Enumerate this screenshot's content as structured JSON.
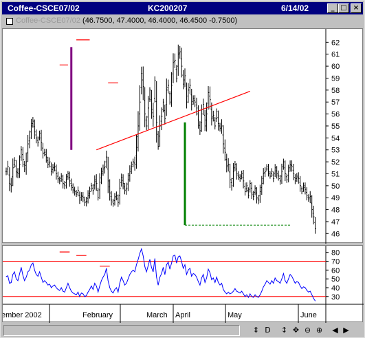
{
  "window": {
    "title_left": "Coffee-CSCE07/02",
    "title_center": "KC200207",
    "title_right": "6/14/02",
    "btn_min": "_",
    "btn_max": "□",
    "btn_close": "×"
  },
  "infobar": {
    "symbol": "Coffee-CSCE07/02",
    "values": "(46.7500, 47.4000, 46.4000, 46.4500 -0.7500)"
  },
  "statusbar": {
    "icons": [
      "scroll-arrows-icon",
      "draw-icon",
      "move-vertical-icon",
      "crosshair-icon",
      "zoom-out-icon",
      "zoom-in-icon",
      "scroll-left-icon",
      "scroll-right-icon"
    ],
    "glyphs": [
      "⇕",
      "D",
      "↕",
      "✥",
      "⊖",
      "⊕",
      "◀",
      "▶"
    ]
  },
  "chart_data": [
    {
      "type": "ohlc",
      "xlabels": [
        "ember 2002",
        "February",
        "March",
        "April",
        "May",
        "June"
      ],
      "ylim": [
        45.5,
        63
      ],
      "yticks": [
        46,
        47,
        48,
        49,
        50,
        51,
        52,
        53,
        54,
        55,
        56,
        57,
        58,
        59,
        60,
        61,
        62
      ],
      "series_color": "#000000",
      "closes": [
        51.2,
        51.6,
        50.2,
        50.0,
        51.5,
        52.1,
        51.2,
        51.0,
        51.8,
        53.0,
        52.2,
        51.4,
        52.0,
        53.5,
        54.0,
        55.0,
        55.4,
        54.5,
        54.0,
        53.6,
        54.4,
        53.6,
        52.7,
        52.8,
        52.4,
        51.8,
        52.0,
        51.2,
        51.5,
        51.6,
        51.0,
        50.6,
        50.4,
        50.8,
        50.2,
        50.0,
        50.5,
        51.0,
        50.4,
        50.0,
        49.7,
        49.5,
        49.3,
        49.6,
        48.8,
        49.2,
        49.0,
        48.6,
        48.7,
        49.2,
        49.5,
        50.0,
        49.6,
        50.5,
        50.2,
        49.0,
        50.3,
        51.0,
        51.4,
        51.6,
        52.4,
        50.4,
        49.4,
        48.8,
        48.5,
        49.0,
        49.2,
        48.6,
        49.8,
        50.7,
        50.2,
        49.6,
        49.8,
        50.5,
        51.2,
        51.6,
        52.0,
        51.8,
        53.2,
        55.0,
        57.0,
        59.4,
        58.3,
        56.0,
        55.0,
        56.5,
        58.0,
        56.4,
        55.8,
        58.8,
        55.3,
        53.3,
        55.0,
        55.8,
        57.0,
        55.6,
        58.0,
        58.4,
        57.0,
        58.4,
        60.3,
        60.5,
        59.0,
        61.0,
        61.2,
        60.0,
        58.5,
        59.2,
        57.0,
        58.0,
        58.4,
        56.8,
        57.3,
        57.0,
        56.5,
        55.5,
        54.6,
        56.0,
        56.8,
        55.0,
        56.0,
        57.8,
        57.2,
        55.6,
        55.9,
        55.0,
        56.2,
        55.2,
        54.8,
        55.0,
        53.5,
        52.8,
        51.6,
        51.8,
        50.5,
        50.0,
        51.2,
        51.8,
        51.0,
        50.8,
        50.6,
        51.0,
        50.4,
        49.5,
        50.0,
        49.2,
        50.2,
        49.4,
        49.1,
        49.8,
        49.0,
        48.8,
        49.5,
        50.2,
        51.0,
        51.2,
        51.6,
        51.2,
        50.8,
        51.2,
        50.6,
        51.5,
        51.0,
        50.8,
        50.4,
        51.2,
        52.0,
        51.0,
        50.5,
        51.2,
        51.8,
        51.6,
        51.0,
        50.4,
        50.8,
        50.6,
        50.0,
        49.5,
        50.0,
        49.7,
        49.2,
        48.9,
        49.1,
        48.0,
        47.4,
        46.45
      ],
      "annotations": {
        "trendline_red": [
          [
            54,
            53.0
          ],
          [
            146,
            57.9
          ]
        ],
        "purple_bar": [
          [
            39,
            53.0
          ],
          [
            39,
            61.6
          ]
        ],
        "green_vertical": [
          [
            107,
            55.3
          ],
          [
            107,
            46.7
          ]
        ],
        "green_dashed": [
          [
            107,
            46.7
          ],
          [
            170,
            46.7
          ]
        ],
        "red_markers": [
          [
            [
              32,
              37
            ],
            60.1
          ],
          [
            [
              42,
              50
            ],
            62.2
          ],
          [
            [
              61,
              67
            ],
            58.6
          ]
        ]
      }
    },
    {
      "type": "line",
      "ylim": [
        22,
        86
      ],
      "yticks": [
        30,
        40,
        50,
        60,
        70,
        80
      ],
      "series_color": "#0000ff",
      "ref_lines": [
        70,
        30
      ],
      "ref_color": "#ff0000",
      "values": [
        52.5,
        53.5,
        45.0,
        45.8,
        55.0,
        58.0,
        50.0,
        48.0,
        55.5,
        63.0,
        54.0,
        48.0,
        52.0,
        58.0,
        60.0,
        66.0,
        68.0,
        60.0,
        55.0,
        53.0,
        58.0,
        52.0,
        46.0,
        48.0,
        46.0,
        43.0,
        44.0,
        40.0,
        42.0,
        43.0,
        40.0,
        38.0,
        37.0,
        40.0,
        36.0,
        35.0,
        40.0,
        45.0,
        40.0,
        36.0,
        34.0,
        33.0,
        32.0,
        35.0,
        30.0,
        34.0,
        33.0,
        30.0,
        31.0,
        35.0,
        38.0,
        42.0,
        38.0,
        45.0,
        42.0,
        35.0,
        42.0,
        48.0,
        52.0,
        55.0,
        62.0,
        48.0,
        40.0,
        36.0,
        34.0,
        38.0,
        40.0,
        35.0,
        45.0,
        52.0,
        48.0,
        43.0,
        45.0,
        50.0,
        55.0,
        58.0,
        60.0,
        58.0,
        66.0,
        72.0,
        79.0,
        84.0,
        76.0,
        64.0,
        58.0,
        65.0,
        72.0,
        63.0,
        58.0,
        73.0,
        52.0,
        43.0,
        52.0,
        56.0,
        63.0,
        55.0,
        66.0,
        69.0,
        61.0,
        68.0,
        76.0,
        77.0,
        68.0,
        75.0,
        76.0,
        70.0,
        62.0,
        66.0,
        55.0,
        60.0,
        62.0,
        53.0,
        56.0,
        55.0,
        52.0,
        47.0,
        43.0,
        51.0,
        55.0,
        46.0,
        51.0,
        61.0,
        57.0,
        49.0,
        51.0,
        46.0,
        52.0,
        46.0,
        43.0,
        45.0,
        38.0,
        35.0,
        33.0,
        35.0,
        33.0,
        34.0,
        36.0,
        39.0,
        36.0,
        35.0,
        34.0,
        36.0,
        33.0,
        30.0,
        32.0,
        29.0,
        33.0,
        30.0,
        29.0,
        32.0,
        30.0,
        29.0,
        32.0,
        36.0,
        41.0,
        44.0,
        48.0,
        46.0,
        44.0,
        48.0,
        45.0,
        51.0,
        48.0,
        47.0,
        45.0,
        50.0,
        56.0,
        48.0,
        45.0,
        50.0,
        55.0,
        53.0,
        49.0,
        45.0,
        47.0,
        46.0,
        42.0,
        39.0,
        41.0,
        40.0,
        37.0,
        35.0,
        36.0,
        32.0,
        28.0,
        25.0
      ],
      "red_markers": [
        [
          [
            32,
            38
          ],
          80.5
        ],
        [
          [
            42,
            48
          ],
          76.5
        ],
        [
          [
            56,
            62
          ],
          64.5
        ]
      ]
    }
  ]
}
